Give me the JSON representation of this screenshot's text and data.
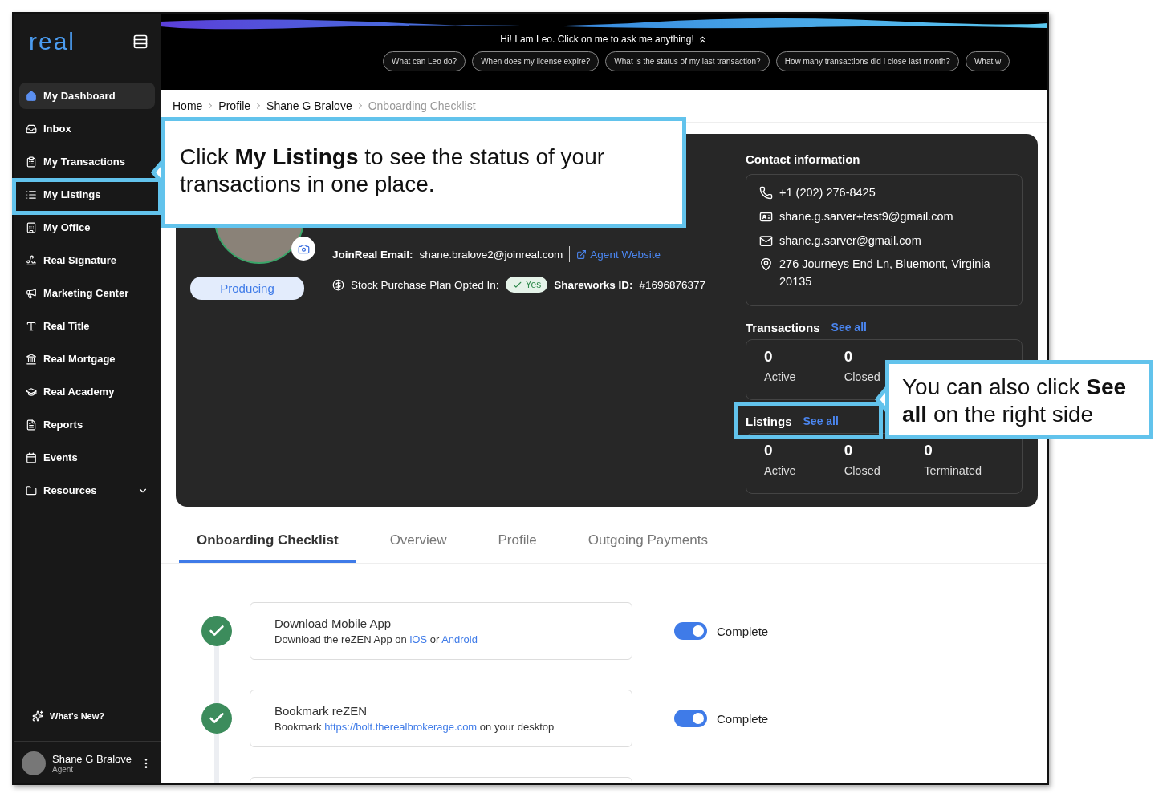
{
  "sidebar": {
    "logo": "real",
    "items": [
      {
        "label": "My Dashboard",
        "selected": true,
        "expandable": false
      },
      {
        "label": "Inbox",
        "selected": false,
        "expandable": false
      },
      {
        "label": "My Transactions",
        "selected": false,
        "expandable": false
      },
      {
        "label": "My Listings",
        "selected": false,
        "expandable": false
      },
      {
        "label": "My Office",
        "selected": false,
        "expandable": false
      },
      {
        "label": "Real Signature",
        "selected": false,
        "expandable": false
      },
      {
        "label": "Marketing Center",
        "selected": false,
        "expandable": false
      },
      {
        "label": "Real Title",
        "selected": false,
        "expandable": false
      },
      {
        "label": "Real Mortgage",
        "selected": false,
        "expandable": false
      },
      {
        "label": "Real Academy",
        "selected": false,
        "expandable": false
      },
      {
        "label": "Reports",
        "selected": false,
        "expandable": false
      },
      {
        "label": "Events",
        "selected": false,
        "expandable": false
      },
      {
        "label": "Resources",
        "selected": false,
        "expandable": true
      }
    ],
    "whats_new": "What's New?",
    "user": {
      "name": "Shane G Bralove",
      "role": "Agent"
    }
  },
  "leo": {
    "prompt": "Hi! I am Leo. Click on me to ask me anything!",
    "suggestions": [
      "What can Leo do?",
      "When does my license expire?",
      "What is the status of my last transaction?",
      "How many transactions did I close last month?",
      "What w"
    ]
  },
  "breadcrumb": [
    {
      "label": "Home",
      "current": false
    },
    {
      "label": "Profile",
      "current": false
    },
    {
      "label": "Shane G Bralove",
      "current": false
    },
    {
      "label": "Onboarding Checklist",
      "current": true
    }
  ],
  "profile": {
    "status": "Producing",
    "email_label": "JoinReal Email:",
    "email": "shane.bralove2@joinreal.com",
    "website": "Agent Website",
    "stock_label": "Stock Purchase Plan Opted In:",
    "stock_value": "Yes",
    "shareworks_label": "Shareworks ID:",
    "shareworks_id": "#1696876377"
  },
  "contact": {
    "title": "Contact information",
    "items": [
      {
        "kind": "phone",
        "text": "+1 (202) 276-8425"
      },
      {
        "kind": "id",
        "text": "shane.g.sarver+test9@gmail.com"
      },
      {
        "kind": "email",
        "text": "shane.g.sarver@gmail.com"
      },
      {
        "kind": "address",
        "text": "276 Journeys End Ln, Bluemont, Virginia 20135"
      }
    ]
  },
  "transactions": {
    "title": "Transactions",
    "see_all": "See all",
    "stats": [
      {
        "value": "0",
        "label": "Active"
      },
      {
        "value": "0",
        "label": "Closed"
      }
    ]
  },
  "listings": {
    "title": "Listings",
    "see_all": "See all",
    "stats": [
      {
        "value": "0",
        "label": "Active"
      },
      {
        "value": "0",
        "label": "Closed"
      },
      {
        "value": "0",
        "label": "Terminated"
      }
    ]
  },
  "tabs": [
    {
      "label": "Onboarding Checklist",
      "selected": true
    },
    {
      "label": "Overview",
      "selected": false
    },
    {
      "label": "Profile",
      "selected": false
    },
    {
      "label": "Outgoing Payments",
      "selected": false
    }
  ],
  "checklist": [
    {
      "title": "Download Mobile App",
      "description": [
        {
          "text": "Download the reZEN App on ",
          "link": false
        },
        {
          "text": "iOS",
          "link": true
        },
        {
          "text": " or ",
          "link": false
        },
        {
          "text": "Android",
          "link": true
        }
      ],
      "complete": true,
      "status": "Complete"
    },
    {
      "title": "Bookmark reZEN",
      "description": [
        {
          "text": "Bookmark ",
          "link": false
        },
        {
          "text": "https://bolt.therealbrokerage.com",
          "link": true
        },
        {
          "text": " on your desktop",
          "link": false
        }
      ],
      "complete": true,
      "status": "Complete"
    }
  ],
  "callouts": [
    {
      "text": "Click **My Listings** to see the status of your transactions in one place."
    },
    {
      "text": "You can also click **See all** on the right side"
    }
  ]
}
